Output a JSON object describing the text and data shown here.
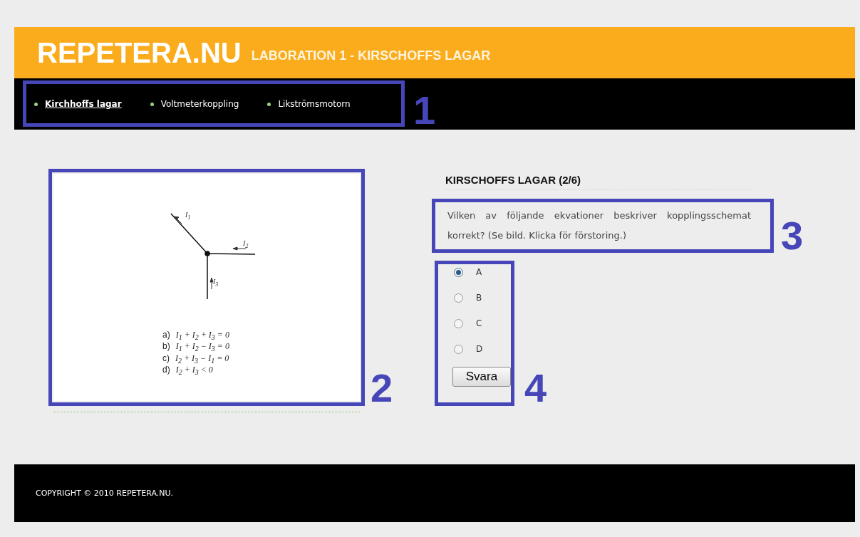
{
  "header": {
    "logo": "REPETERA.NU",
    "subtitle": "LABORATION 1 - KIRSCHOFFS LAGAR"
  },
  "nav": [
    {
      "label": "Kirchhoffs lagar",
      "selected": true
    },
    {
      "label": "Voltmeterkoppling",
      "selected": false
    },
    {
      "label": "Likströmsmotorn",
      "selected": false
    }
  ],
  "figure": {
    "current_labels": [
      "I$_{1}$",
      "I$_{2}$",
      "I$_{3}$"
    ],
    "equations": [
      {
        "letter": "a)",
        "formula": "I$_{1}$ + I$_{2}$ + I$_{3}$ = 0"
      },
      {
        "letter": "b)",
        "formula": "I$_{1}$ + I$_{2}$ − I$_{3}$ = 0"
      },
      {
        "letter": "c)",
        "formula": "I$_{2}$ + I$_{3}$ − I$_{1}$ = 0"
      },
      {
        "letter": "d)",
        "formula": "I$_{2}$ + I$_{3}$ < 0"
      }
    ]
  },
  "question": {
    "title": "KIRSCHOFFS LAGAR (2/6)",
    "text": "Vilken av följande ekvationer beskriver kopplingsschemat korrekt? (Se bild. Klicka för förstoring.)",
    "options": [
      {
        "label": "A",
        "selected": true
      },
      {
        "label": "B",
        "selected": false
      },
      {
        "label": "C",
        "selected": false
      },
      {
        "label": "D",
        "selected": false
      }
    ],
    "submit": "Svara"
  },
  "footer": "COPYRIGHT © 2010 REPETERA.NU.",
  "annotations": [
    "1",
    "2",
    "3",
    "4"
  ]
}
